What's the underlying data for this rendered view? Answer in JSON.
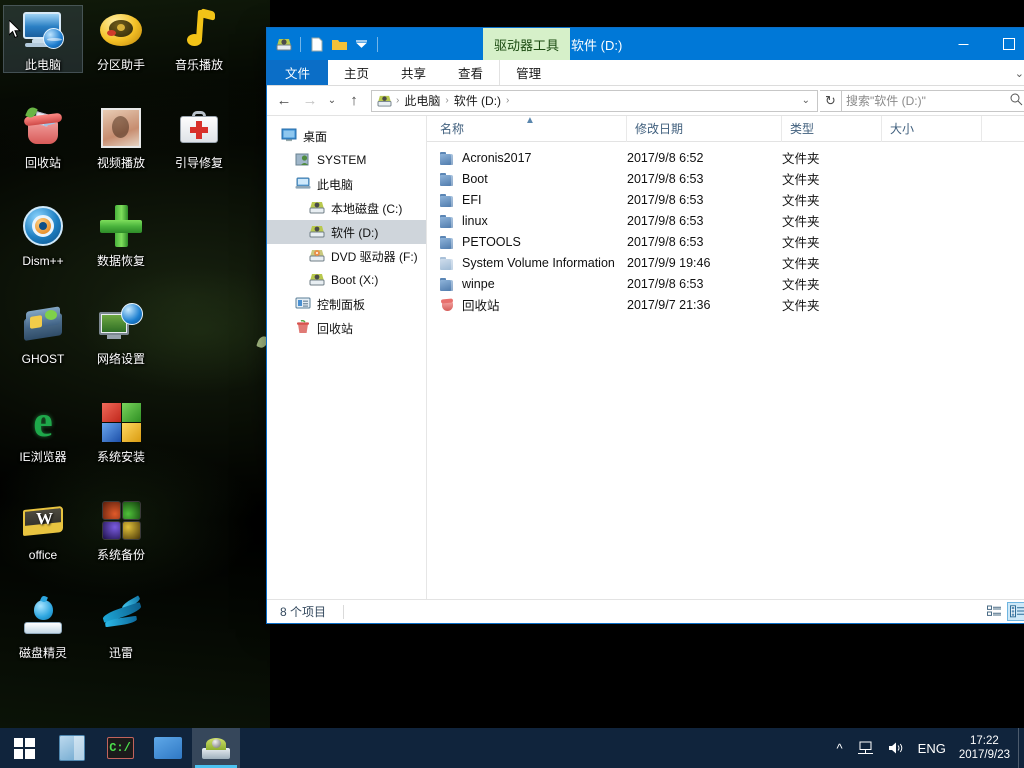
{
  "desktop": {
    "icons": [
      {
        "label": "此电脑",
        "icon": "this-pc-icon",
        "selected": true
      },
      {
        "label": "分区助手",
        "icon": "partition-assistant-icon",
        "selected": false
      },
      {
        "label": "音乐播放",
        "icon": "music-player-icon",
        "selected": false
      },
      {
        "label": "回收站",
        "icon": "recycle-bin-icon",
        "selected": false
      },
      {
        "label": "视频播放",
        "icon": "video-player-icon",
        "selected": false
      },
      {
        "label": "引导修复",
        "icon": "boot-repair-icon",
        "selected": false
      },
      {
        "label": "Dism++",
        "icon": "dism-icon",
        "selected": false
      },
      {
        "label": "数据恢复",
        "icon": "data-recovery-icon",
        "selected": false
      },
      {
        "label": "GHOST",
        "icon": "ghost-icon",
        "selected": false
      },
      {
        "label": "网络设置",
        "icon": "network-settings-icon",
        "selected": false
      },
      {
        "label": "IE浏览器",
        "icon": "internet-explorer-icon",
        "selected": false
      },
      {
        "label": "系统安装",
        "icon": "system-install-icon",
        "selected": false
      },
      {
        "label": "office",
        "icon": "office-icon",
        "selected": false
      },
      {
        "label": "系统备份",
        "icon": "system-backup-icon",
        "selected": false
      },
      {
        "label": "磁盘精灵",
        "icon": "disk-genius-icon",
        "selected": false
      },
      {
        "label": "迅雷",
        "icon": "thunder-download-icon",
        "selected": false
      }
    ]
  },
  "explorer": {
    "title": "软件 (D:)",
    "contextual_tab": "驱动器工具",
    "quick_access": [
      "drive-icon",
      "new-file-icon",
      "new-folder-icon",
      "customize-dropdown-icon"
    ],
    "window_buttons": {
      "minimize": "—",
      "maximize": "☐"
    },
    "ribbon_tabs": [
      {
        "label": "文件",
        "active_style": "file"
      },
      {
        "label": "主页",
        "active_style": "normal"
      },
      {
        "label": "共享",
        "active_style": "normal"
      },
      {
        "label": "查看",
        "active_style": "normal"
      },
      {
        "label": "管理",
        "active_style": "contextual"
      }
    ],
    "address": {
      "back": "←",
      "forward": "→",
      "history": "⌄",
      "up": "↑",
      "crumbs": [
        "此电脑",
        "软件 (D:)"
      ],
      "refresh": "↻"
    },
    "search": {
      "placeholder": "搜索\"软件 (D:)\"",
      "icon": "search-icon"
    },
    "nav_tree": [
      {
        "label": "桌面",
        "icon": "desktop-icon",
        "indent": 0,
        "selected": false
      },
      {
        "label": "SYSTEM",
        "icon": "user-folder-icon",
        "indent": 1,
        "selected": false
      },
      {
        "label": "此电脑",
        "icon": "this-pc-icon",
        "indent": 1,
        "selected": false
      },
      {
        "label": "本地磁盘 (C:)",
        "icon": "drive-icon",
        "indent": 2,
        "selected": false
      },
      {
        "label": "软件 (D:)",
        "icon": "drive-icon",
        "indent": 2,
        "selected": true
      },
      {
        "label": "DVD 驱动器 (F:)",
        "icon": "dvd-drive-icon",
        "indent": 2,
        "selected": false
      },
      {
        "label": "Boot (X:)",
        "icon": "drive-icon",
        "indent": 2,
        "selected": false
      },
      {
        "label": "控制面板",
        "icon": "control-panel-icon",
        "indent": 1,
        "selected": false
      },
      {
        "label": "回收站",
        "icon": "recycle-bin-icon",
        "indent": 1,
        "selected": false
      }
    ],
    "columns": [
      {
        "key": "name",
        "label": "名称",
        "sorted": true,
        "sort_dir": "asc"
      },
      {
        "key": "date",
        "label": "修改日期"
      },
      {
        "key": "type",
        "label": "类型"
      },
      {
        "key": "size",
        "label": "大小"
      }
    ],
    "files": [
      {
        "name": "Acronis2017",
        "date": "2017/9/8 6:52",
        "type": "文件夹",
        "size": "",
        "icon": "folder-icon"
      },
      {
        "name": "Boot",
        "date": "2017/9/8 6:53",
        "type": "文件夹",
        "size": "",
        "icon": "folder-icon"
      },
      {
        "name": "EFI",
        "date": "2017/9/8 6:53",
        "type": "文件夹",
        "size": "",
        "icon": "folder-icon"
      },
      {
        "name": "linux",
        "date": "2017/9/8 6:53",
        "type": "文件夹",
        "size": "",
        "icon": "folder-icon"
      },
      {
        "name": "PETOOLS",
        "date": "2017/9/8 6:53",
        "type": "文件夹",
        "size": "",
        "icon": "folder-icon"
      },
      {
        "name": "System Volume Information",
        "date": "2017/9/9 19:46",
        "type": "文件夹",
        "size": "",
        "icon": "folder-hidden-icon"
      },
      {
        "name": "winpe",
        "date": "2017/9/8 6:53",
        "type": "文件夹",
        "size": "",
        "icon": "folder-icon"
      },
      {
        "name": "回收站",
        "date": "2017/9/7 21:36",
        "type": "文件夹",
        "size": "",
        "icon": "recycle-bin-icon"
      }
    ],
    "status": {
      "item_count": "8 个项目"
    },
    "view_buttons": [
      {
        "name": "details-view",
        "active": false
      },
      {
        "name": "large-icons-view",
        "active": true
      }
    ]
  },
  "taskbar": {
    "start": "start-button",
    "items": [
      {
        "name": "store-icon",
        "active": false
      },
      {
        "name": "command-prompt-icon",
        "active": false
      },
      {
        "name": "explorer-desktop-icon",
        "active": false
      },
      {
        "name": "file-explorer-icon",
        "active": true
      }
    ],
    "tray": {
      "overflow": "^",
      "network": "network-icon",
      "volume": "volume-icon",
      "language": "ENG",
      "time": "17:22",
      "date": "2017/9/23"
    }
  },
  "colors": {
    "accent": "#0078d7",
    "contextual_tab": "#d6f0c9",
    "taskbar": "#10243c",
    "selection": "#cfd5db"
  }
}
